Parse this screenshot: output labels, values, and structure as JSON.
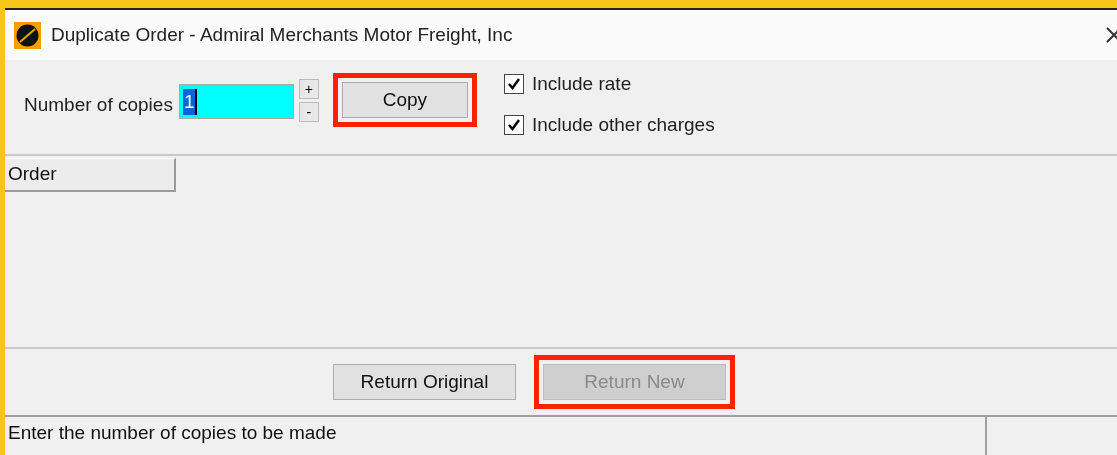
{
  "window": {
    "title": "Duplicate Order - Admiral Merchants Motor Freight, Inc"
  },
  "copies": {
    "label": "Number of copies",
    "value": "1",
    "increment": "+",
    "decrement": "-"
  },
  "copy_button": {
    "label": "Copy",
    "highlighted": true,
    "disabled": false
  },
  "options": [
    {
      "label": "Include rate",
      "checked": true
    },
    {
      "label": "Include other charges",
      "checked": true
    }
  ],
  "table": {
    "columns": [
      "Order"
    ]
  },
  "buttons": [
    {
      "label": "Return Original",
      "highlighted": false,
      "disabled": false
    },
    {
      "label": "Return New",
      "highlighted": true,
      "disabled": true
    }
  ],
  "status_bar": {
    "message": "Enter the number of copies to be made"
  }
}
